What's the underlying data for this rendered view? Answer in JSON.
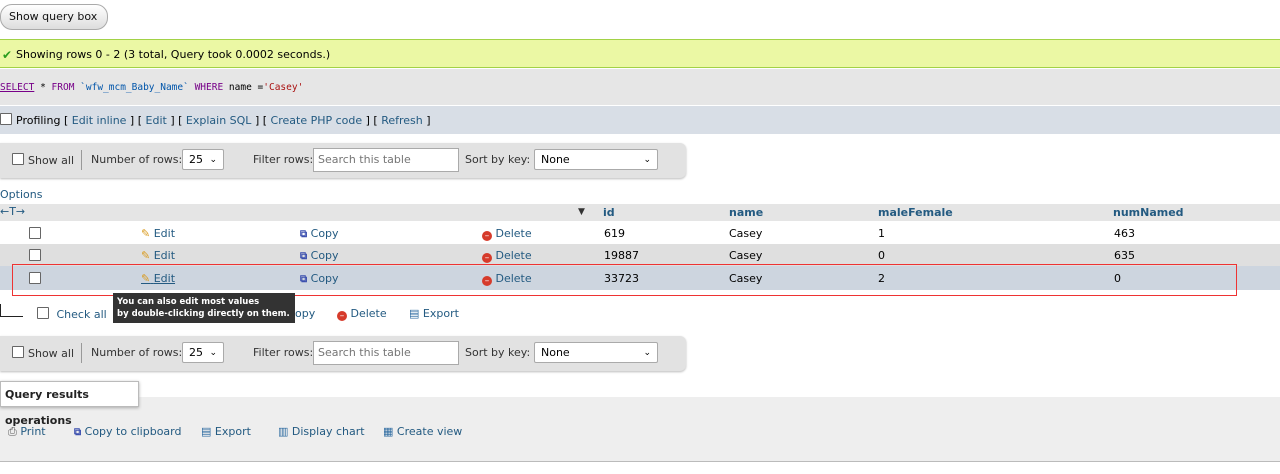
{
  "show_query_box": "Show query box",
  "success_message": "Showing rows 0 - 2 (3 total, Query took 0.0002 seconds.)",
  "sql": {
    "select": "SELECT",
    "star": "*",
    "from": "FROM",
    "table": "`wfw_mcm_Baby_Name`",
    "where": "WHERE",
    "column": "name",
    "eq": "=",
    "value": "'Casey'"
  },
  "profiling": {
    "label": "Profiling",
    "links": [
      "Edit inline",
      "Edit",
      "Explain SQL",
      "Create PHP code",
      "Refresh"
    ]
  },
  "navbar": {
    "show_all": "Show all",
    "number_of_rows_label": "Number of rows:",
    "number_of_rows_value": "25",
    "filter_rows_label": "Filter rows:",
    "filter_placeholder": "Search this table",
    "sort_by_key_label": "Sort by key:",
    "sort_by_key_value": "None"
  },
  "options_label": "Options",
  "table": {
    "columns": [
      "id",
      "name",
      "maleFemale",
      "numNamed"
    ],
    "action_labels": {
      "edit": "Edit",
      "copy": "Copy",
      "delete": "Delete"
    },
    "rows": [
      {
        "id": "619",
        "name": "Casey",
        "maleFemale": "1",
        "numNamed": "463"
      },
      {
        "id": "19887",
        "name": "Casey",
        "maleFemale": "0",
        "numNamed": "635"
      },
      {
        "id": "33723",
        "name": "Casey",
        "maleFemale": "2",
        "numNamed": "0"
      }
    ]
  },
  "tooltip": {
    "line1": "You can also edit most values",
    "line2": "by double-clicking directly on them."
  },
  "bulk_actions": {
    "check_all": "Check all",
    "copy_partial": "opy",
    "delete": "Delete",
    "export": "Export"
  },
  "query_results_operations": {
    "title": "Query results operations",
    "actions": [
      "Print",
      "Copy to clipboard",
      "Export",
      "Display chart",
      "Create view"
    ]
  }
}
